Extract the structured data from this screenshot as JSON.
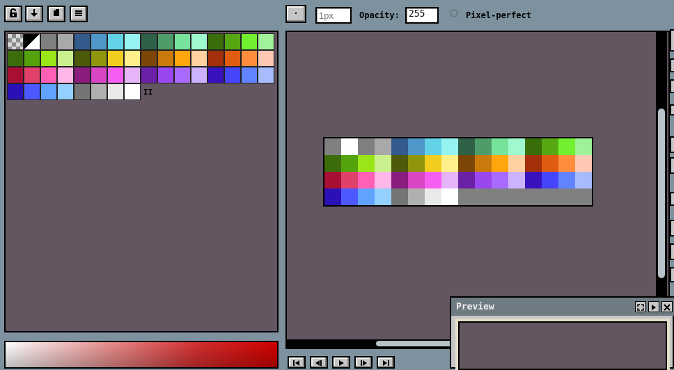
{
  "toolbar_left": {
    "icons": [
      "lock-icon",
      "arrow-down-icon",
      "square-icon",
      "menu-icon"
    ]
  },
  "brush": {
    "size_value": "",
    "size_placeholder": "1px",
    "opacity_label": "Opacity:",
    "opacity_value": "255",
    "pixel_perfect_label": "Pixel-perfect",
    "pixel_perfect_checked": false
  },
  "palette": {
    "resize_handle": "II",
    "colors": [
      "#000000",
      "#ffffff",
      "#808080",
      "#a9a9a9",
      "#335b8e",
      "#4f96c9",
      "#62d2e6",
      "#96f3ef",
      "#2f6148",
      "#4e9c6a",
      "#77e29b",
      "#a0f9ce",
      "#3a6e0b",
      "#57a713",
      "#72f030",
      "#a0f19a",
      "#3d6d0b",
      "#54a30c",
      "#9ae517",
      "#c9f08d",
      "#4d5a0a",
      "#8f960e",
      "#f0cd1e",
      "#fff08b",
      "#7c4607",
      "#c97a0b",
      "#ffa60c",
      "#ffd0a0",
      "#a3300b",
      "#e05c10",
      "#ff8d3d",
      "#ffc8b4",
      "#a80f33",
      "#e0416a",
      "#ff5fb5",
      "#ffb6e9",
      "#8a1c7e",
      "#d845c5",
      "#f45ff2",
      "#e5b5f7",
      "#6b20a8",
      "#9b47f0",
      "#a96bff",
      "#cdb3ff",
      "#3a12bd",
      "#4745fb",
      "#6283ff",
      "#a8bbff",
      "#2b10b5",
      "#4d59ff",
      "#60a3ff",
      "#93d0ff",
      "#757575",
      "#b0b0b0",
      "#e9e9e9",
      "#ffffff"
    ]
  },
  "canvas": {
    "sprite_colors": [
      "#808080",
      "#ffffff",
      "#808080",
      "#a9a9a9",
      "#335b8e",
      "#4f96c9",
      "#62d2e6",
      "#96f3ef",
      "#2f6148",
      "#4e9c6a",
      "#77e29b",
      "#a0f9ce",
      "#3a6e0b",
      "#57a713",
      "#72f030",
      "#a0f19a",
      "#3d6d0b",
      "#54a30c",
      "#9ae517",
      "#c9f08d",
      "#4d5a0a",
      "#8f960e",
      "#f0cd1e",
      "#fff08b",
      "#7c4607",
      "#c97a0b",
      "#ffa60c",
      "#ffd0a0",
      "#a3300b",
      "#e05c10",
      "#ff8d3d",
      "#ffc8b4",
      "#a80f33",
      "#e0416a",
      "#ff5fb5",
      "#ffb6e9",
      "#8a1c7e",
      "#d845c5",
      "#f45ff2",
      "#e5b5f7",
      "#6b20a8",
      "#9b47f0",
      "#a96bff",
      "#cdb3ff",
      "#3a12bd",
      "#4745fb",
      "#6283ff",
      "#a8bbff",
      "#2b10b5",
      "#4d59ff",
      "#60a3ff",
      "#93d0ff",
      "#757575",
      "#b0b0b0",
      "#e9e9e9",
      "#ffffff",
      "#808080",
      "#808080",
      "#808080",
      "#808080",
      "#808080",
      "#808080",
      "#808080",
      "#808080"
    ]
  },
  "preview": {
    "title": "Preview"
  },
  "colors": {
    "app_background": "#7d929e",
    "panel_background": "#635660",
    "button_face": "#c6c6c6",
    "preview_header": "#6e7b83"
  }
}
